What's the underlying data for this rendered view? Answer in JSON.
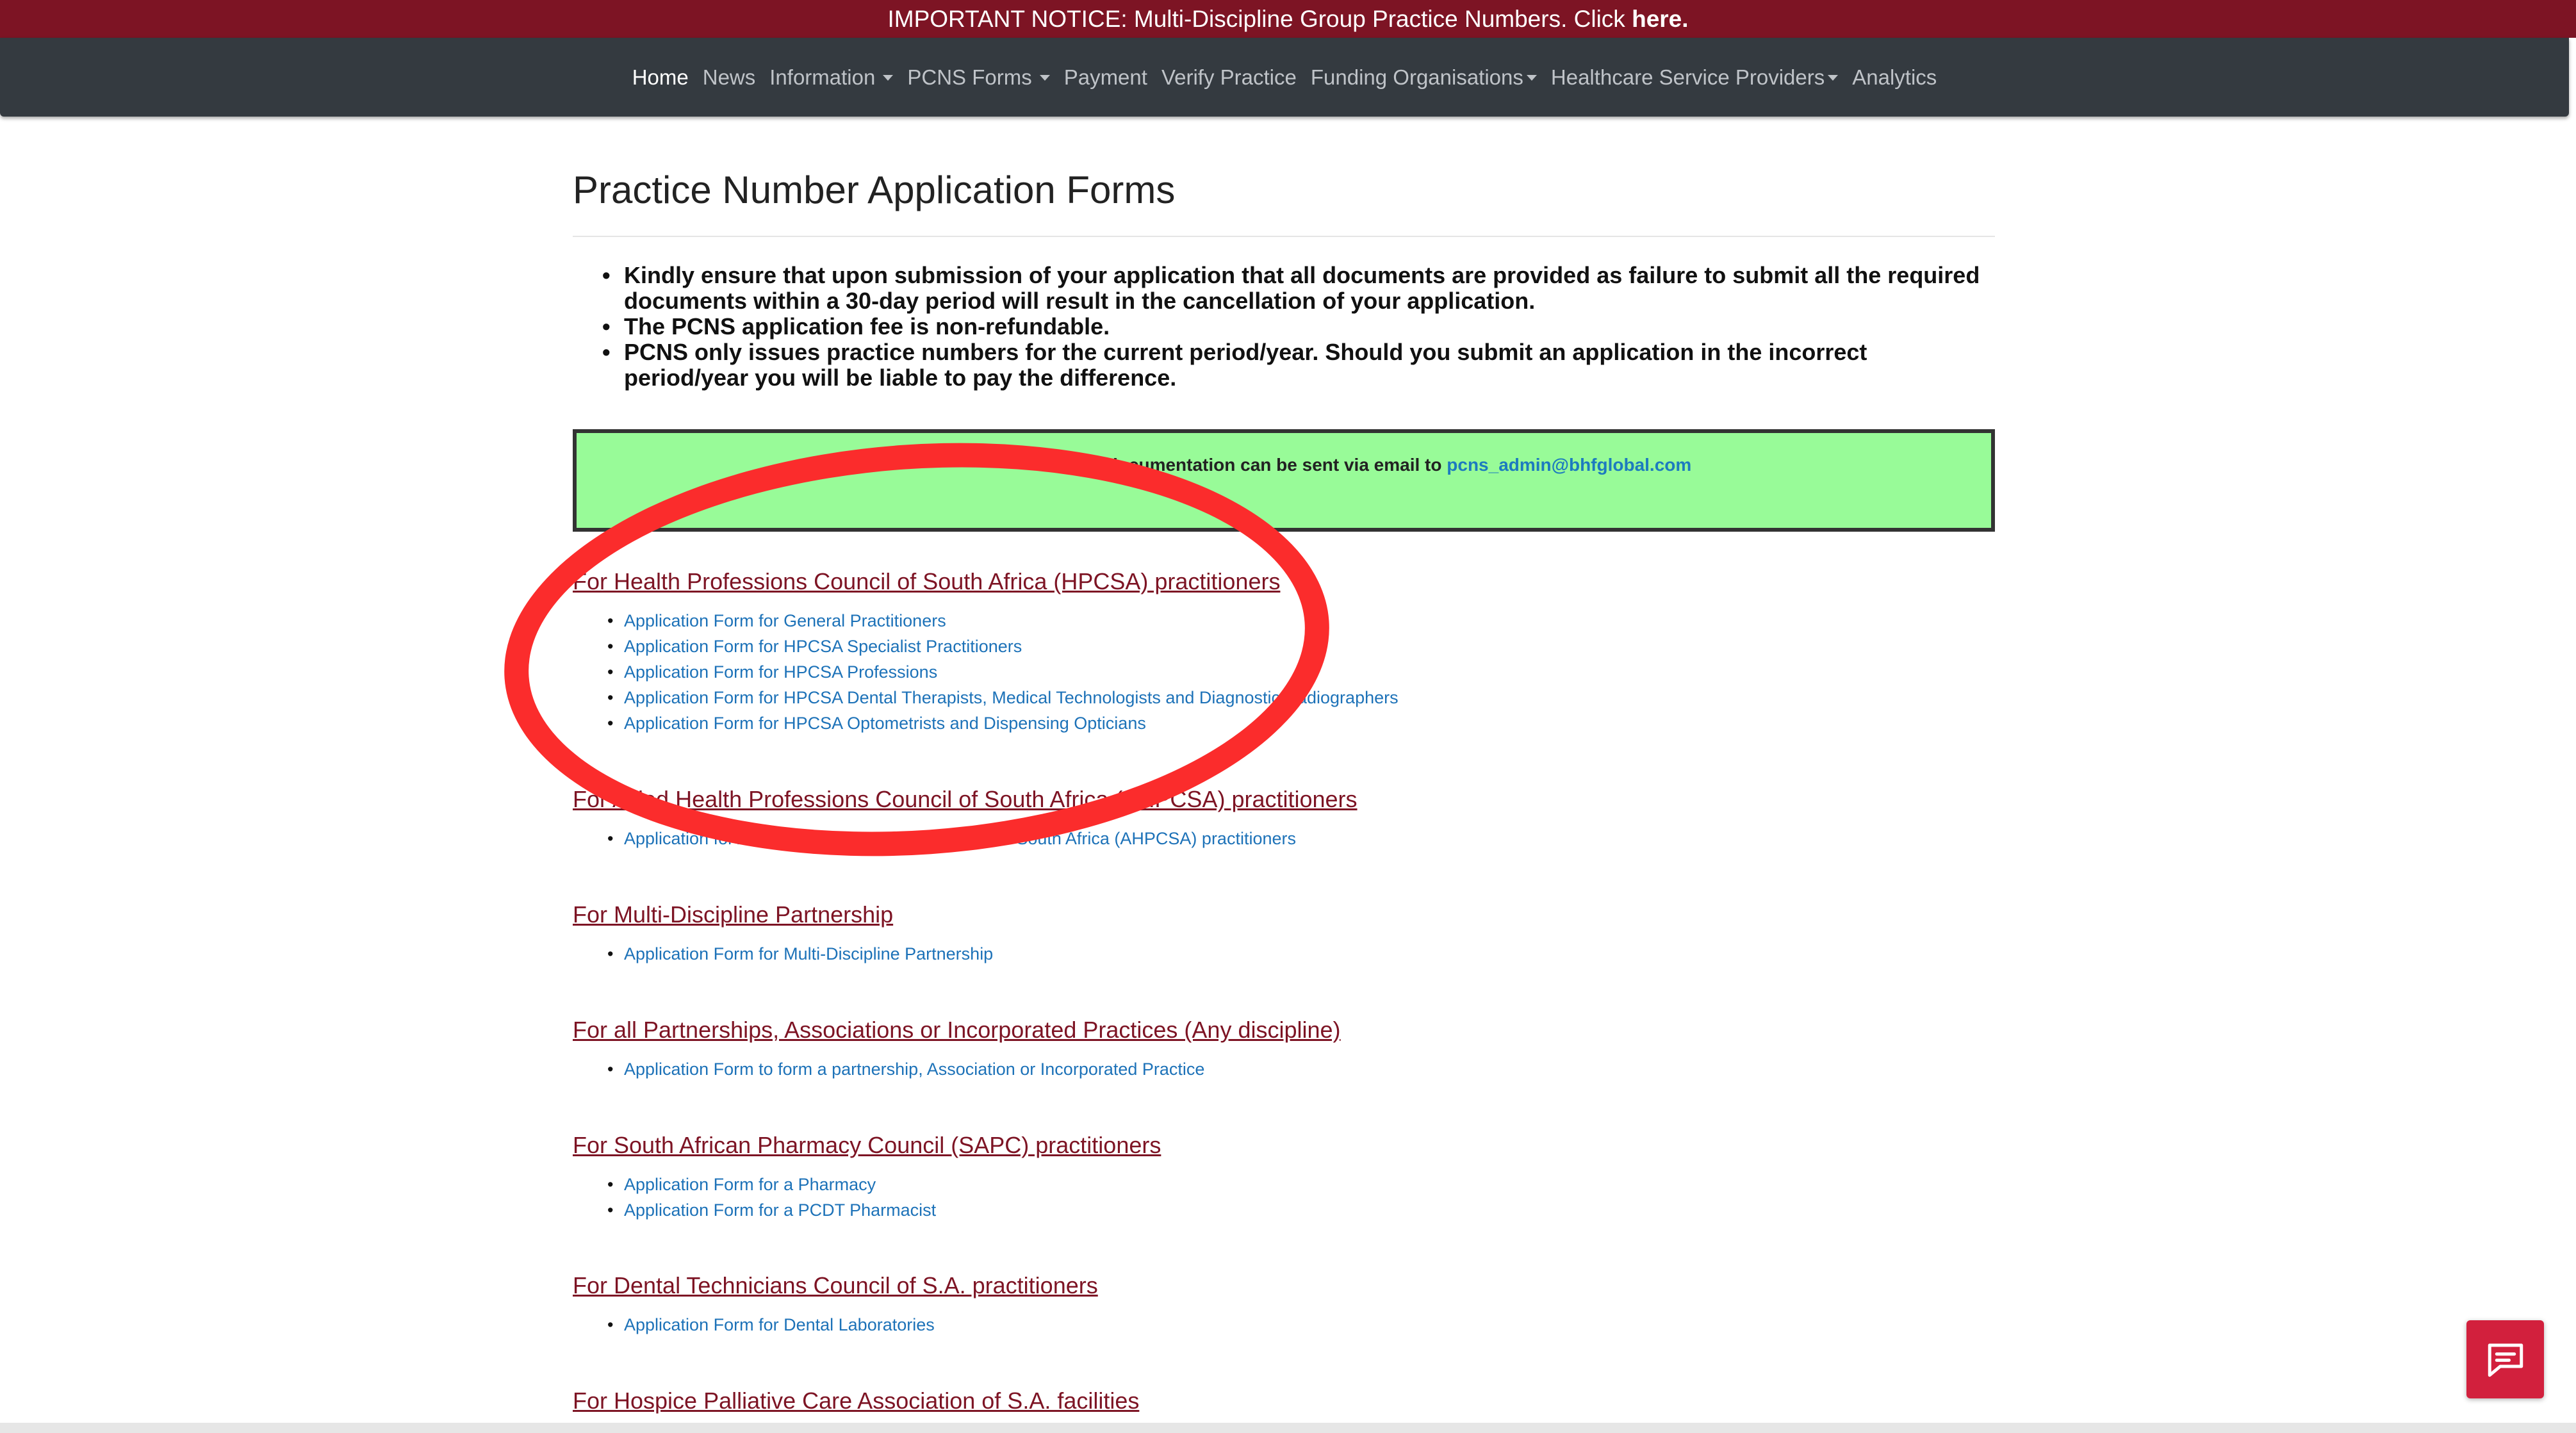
{
  "notice": {
    "text": "IMPORTANT NOTICE: Multi-Discipline Group Practice Numbers. Click ",
    "link": "here."
  },
  "nav": {
    "items": [
      {
        "label": "Home",
        "active": true,
        "dropdown": false
      },
      {
        "label": "News",
        "active": false,
        "dropdown": false
      },
      {
        "label": "Information",
        "active": false,
        "dropdown": true
      },
      {
        "label": "PCNS Forms",
        "active": false,
        "dropdown": true
      },
      {
        "label": "Payment",
        "active": false,
        "dropdown": false
      },
      {
        "label": "Verify Practice",
        "active": false,
        "dropdown": false
      },
      {
        "label": "Funding Organisations",
        "active": false,
        "dropdown": true
      },
      {
        "label": "Healthcare Service Providers",
        "active": false,
        "dropdown": true
      },
      {
        "label": "Analytics",
        "active": false,
        "dropdown": false
      }
    ]
  },
  "page": {
    "title": "Practice Number Application Forms"
  },
  "notes": {
    "item1": "Kindly ensure that upon submission of your application that all documents are provided as failure to submit all the required documents within a 30-day period will result in the cancellation of your application.",
    "item2_prefix": "The PCNS application fee is ",
    "item2_bold": "non-refundable.",
    "item3": "PCNS only issues practice numbers for the current period/year. Should you submit an application in the incorrect period/year you will be liable to pay the difference."
  },
  "green_box": {
    "text": "documentation can be sent via email to ",
    "email": "pcns_admin@bhfglobal.com"
  },
  "sections": [
    {
      "heading": "For Health Professions Council of South Africa (HPCSA) practitioners",
      "links": [
        "Application Form for General Practitioners",
        "Application Form for HPCSA Specialist Practitioners",
        "Application Form for HPCSA Professions",
        "Application Form for HPCSA Dental Therapists, Medical Technologists and Diagnostic Radiographers",
        "Application Form for HPCSA Optometrists and Dispensing Opticians"
      ]
    },
    {
      "heading": "For Allied Health Professions Council of South Africa (AHPCSA) practitioners",
      "links": [
        "Application for Allied Health Professions Council of South Africa (AHPCSA) practitioners"
      ]
    },
    {
      "heading": "For Multi-Discipline Partnership",
      "links": [
        "Application Form for Multi-Discipline Partnership"
      ]
    },
    {
      "heading": "For all Partnerships, Associations or Incorporated Practices (Any discipline)",
      "links": [
        "Application Form to form a partnership, Association or Incorporated Practice"
      ]
    },
    {
      "heading": "For South African Pharmacy Council (SAPC) practitioners",
      "links": [
        "Application Form for a Pharmacy",
        "Application Form for a PCDT Pharmacist"
      ]
    },
    {
      "heading": "For Dental Technicians Council of S.A. practitioners",
      "links": [
        "Application Form for Dental Laboratories"
      ]
    },
    {
      "heading": "For Hospice Palliative Care Association of S.A. facilities",
      "links": []
    }
  ],
  "annotation": {
    "color": "#fb2c2c"
  },
  "colors": {
    "notice_bg": "#7d1424",
    "navbar_bg": "#343a40",
    "heading_link": "#7d1424",
    "link": "#1d72b8",
    "green_box_bg": "#98fb98",
    "chat_button": "#d2203d"
  },
  "icons": {
    "chat": "chat-bubble-icon"
  }
}
